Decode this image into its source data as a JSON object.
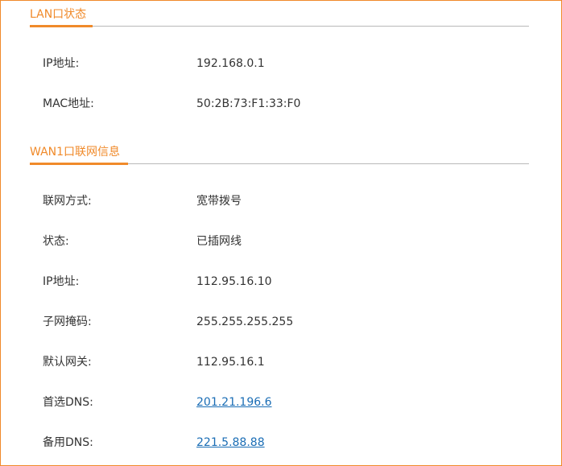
{
  "lan_section": {
    "title": "LAN口状态",
    "rows": [
      {
        "label": "IP地址:",
        "value": "192.168.0.1"
      },
      {
        "label": "MAC地址:",
        "value": "50:2B:73:F1:33:F0"
      }
    ]
  },
  "wan_section": {
    "title": "WAN1口联网信息",
    "rows": [
      {
        "label": "联网方式:",
        "value": "宽带拨号"
      },
      {
        "label": "状态:",
        "value": "已插网线"
      },
      {
        "label": "IP地址:",
        "value": "112.95.16.10"
      },
      {
        "label": "子网掩码:",
        "value": "255.255.255.255"
      },
      {
        "label": "默认网关:",
        "value": "112.95.16.1"
      },
      {
        "label": "首选DNS:",
        "value": "201.21.196.6"
      },
      {
        "label": "备用DNS:",
        "value": "221.5.88.88"
      }
    ]
  },
  "colors": {
    "accent": "#f08a2a",
    "link": "#1a6db5",
    "text": "#333333",
    "rule": "#b8b8b8"
  }
}
